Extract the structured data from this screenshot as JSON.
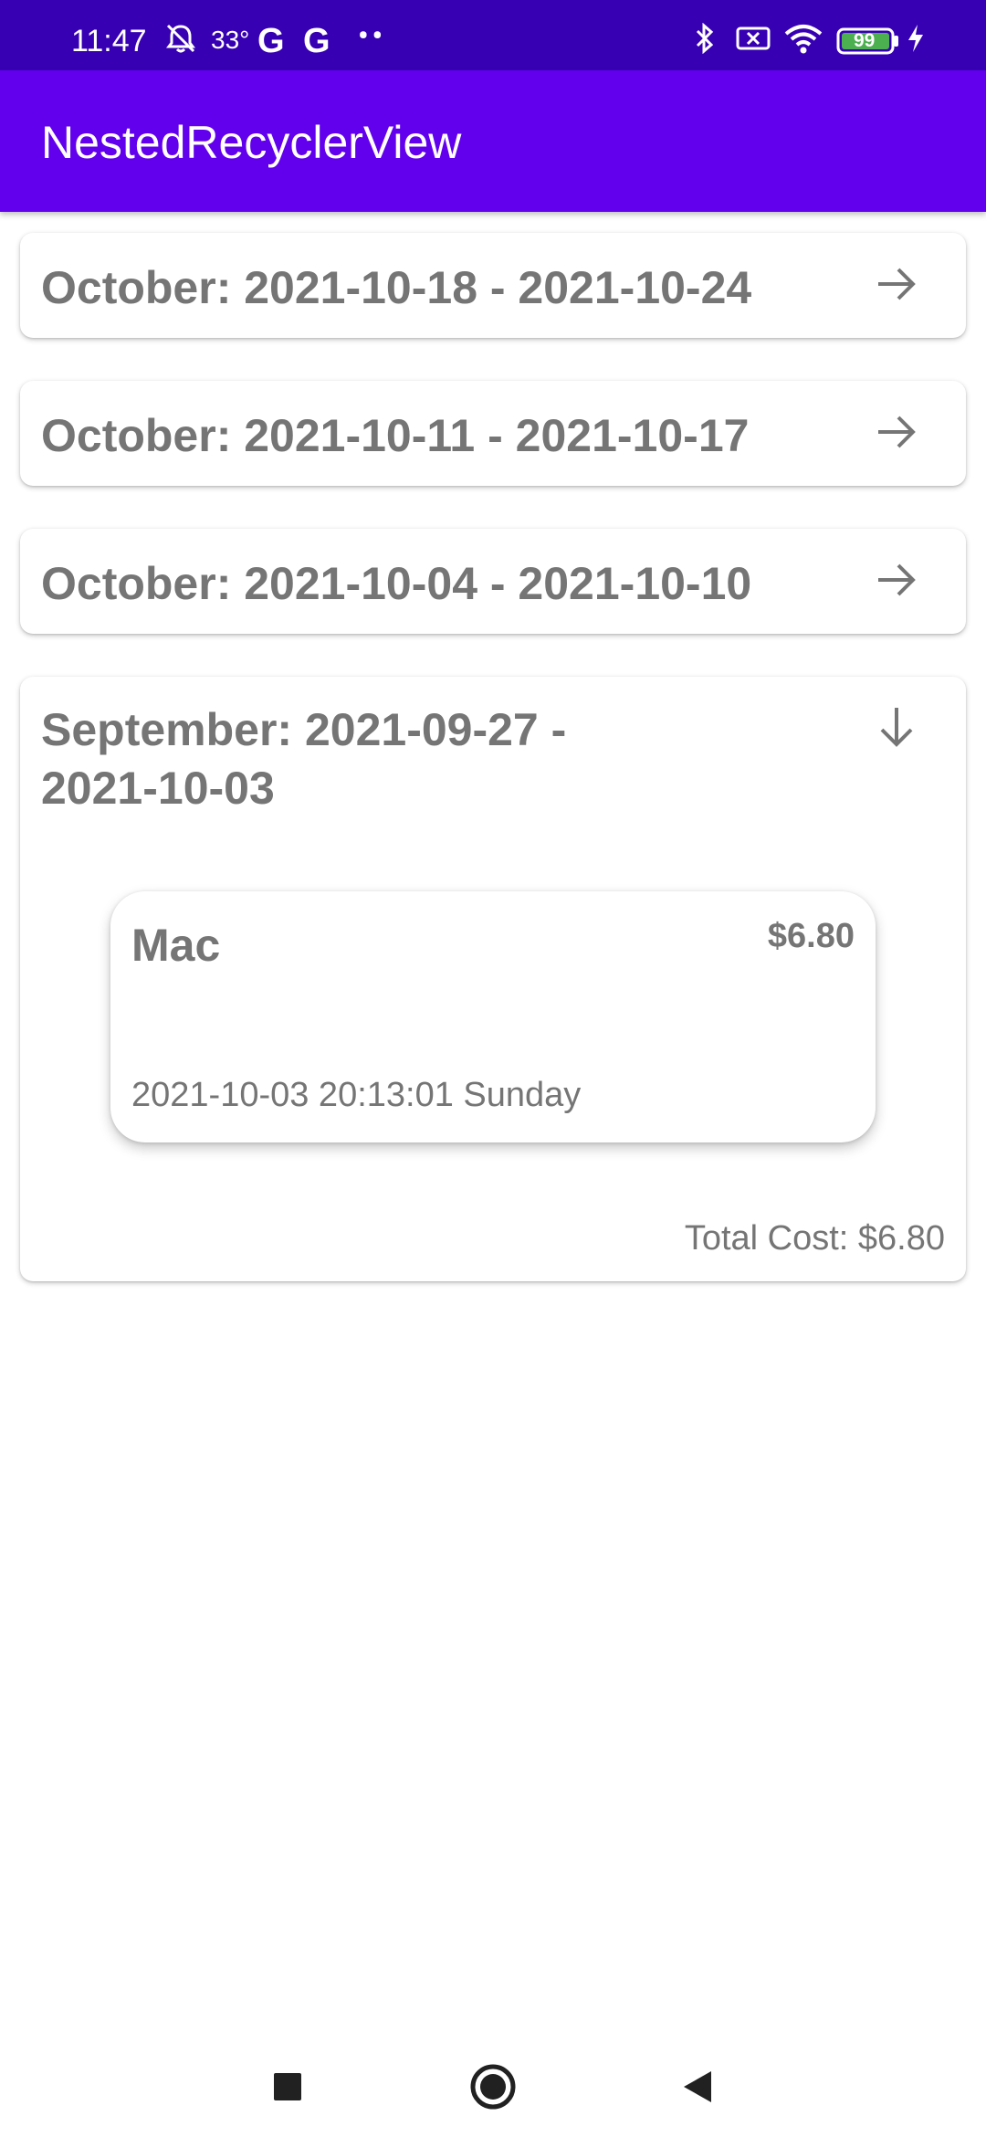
{
  "status_bar": {
    "time": "11:47",
    "temperature": "33°",
    "google_1": "G",
    "google_2": "G",
    "overflow_dots": "••",
    "battery": "99"
  },
  "app_bar": {
    "title": "NestedRecyclerView"
  },
  "weeks": [
    {
      "title": "October: 2021-10-18 - 2021-10-24",
      "expanded": false
    },
    {
      "title": "October: 2021-10-11 - 2021-10-17",
      "expanded": false
    },
    {
      "title": "October: 2021-10-04 - 2021-10-10",
      "expanded": false
    },
    {
      "title_line1": "September: 2021-09-27 -",
      "title_line2": "2021-10-03",
      "expanded": true,
      "expenses": [
        {
          "name": "Mac",
          "amount": "$6.80",
          "datetime": "2021-10-03 20:13:01 Sunday"
        }
      ],
      "total_cost": "Total Cost: $6.80"
    }
  ],
  "colors": {
    "status_bar": "#3700B3",
    "app_bar": "#6200EE",
    "text": "#757575"
  }
}
